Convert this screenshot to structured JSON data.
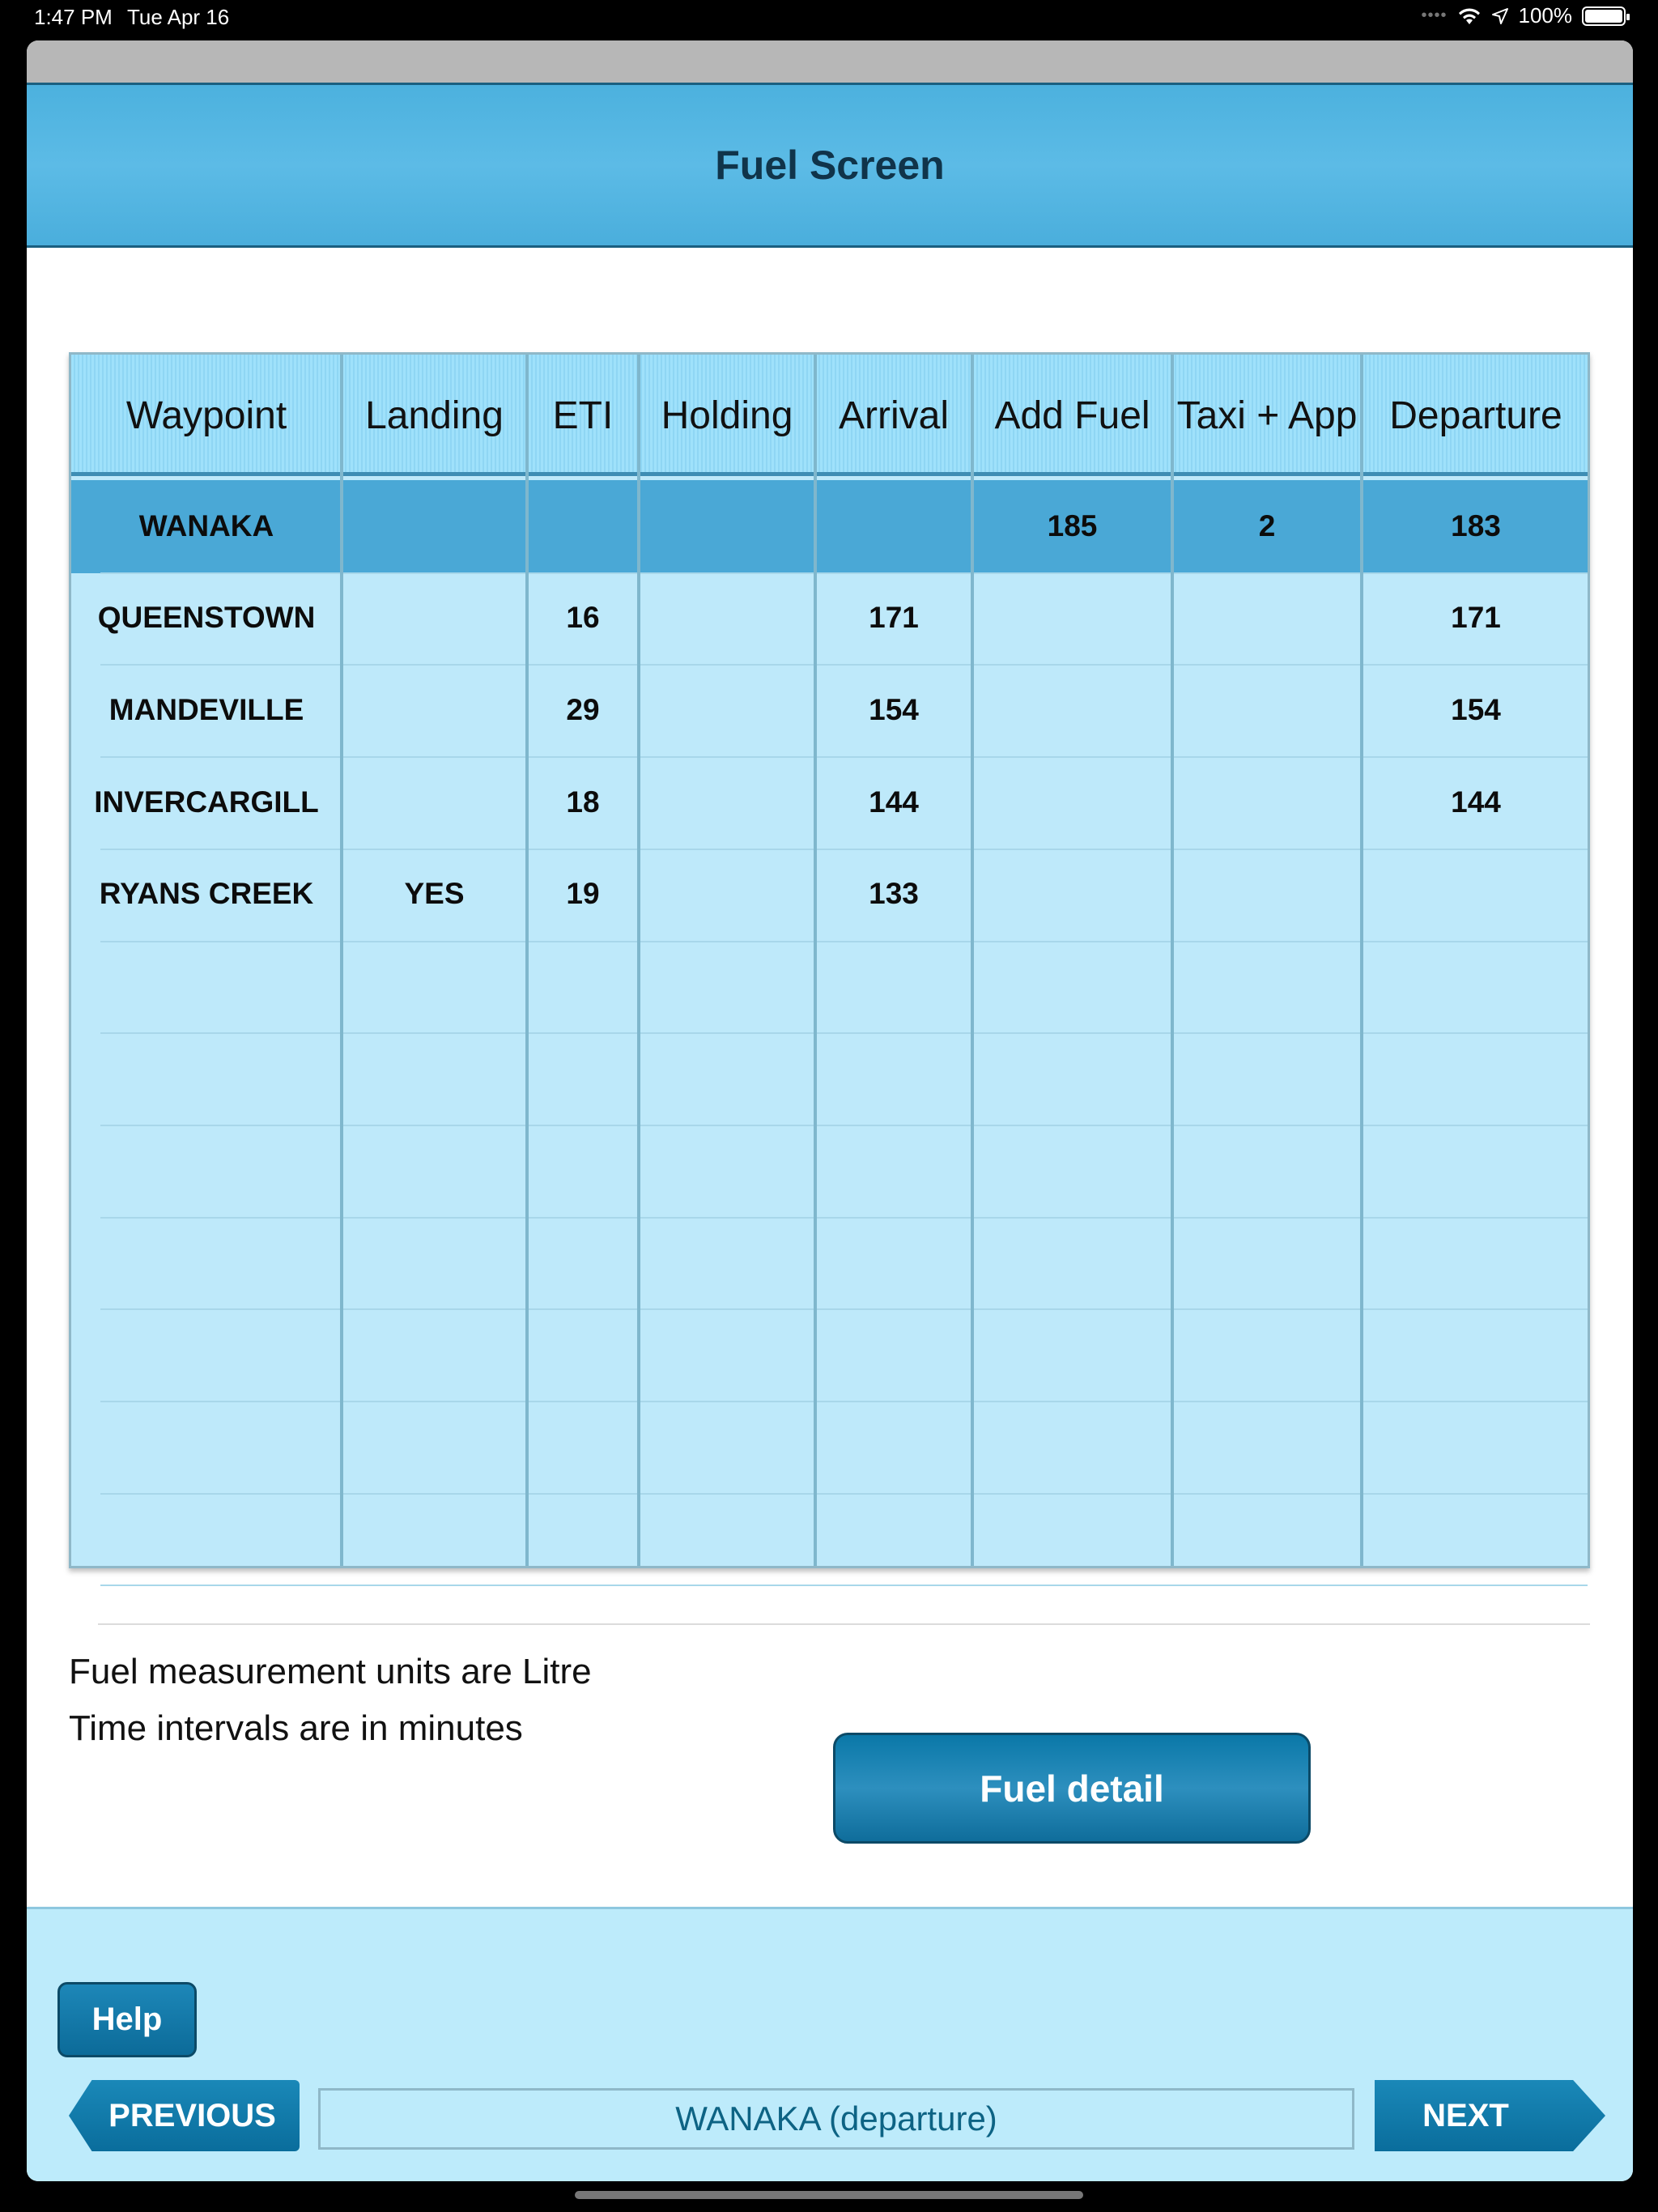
{
  "status_bar": {
    "time": "1:47 PM",
    "date": "Tue Apr 16",
    "battery": "100%"
  },
  "header": {
    "title": "Fuel Screen"
  },
  "table": {
    "columns": [
      "Waypoint",
      "Landing",
      "ETI",
      "Holding",
      "Arrival",
      "Add Fuel",
      "Taxi + App",
      "Departure"
    ],
    "rows": [
      {
        "waypoint": "WANAKA",
        "landing": "",
        "eti": "",
        "holding": "",
        "arrival": "",
        "add_fuel": "185",
        "taxi_app": "2",
        "departure": "183"
      },
      {
        "waypoint": "QUEENSTOWN",
        "landing": "",
        "eti": "16",
        "holding": "",
        "arrival": "171",
        "add_fuel": "",
        "taxi_app": "",
        "departure": "171"
      },
      {
        "waypoint": "MANDEVILLE",
        "landing": "",
        "eti": "29",
        "holding": "",
        "arrival": "154",
        "add_fuel": "",
        "taxi_app": "",
        "departure": "154"
      },
      {
        "waypoint": "INVERCARGILL",
        "landing": "",
        "eti": "18",
        "holding": "",
        "arrival": "144",
        "add_fuel": "",
        "taxi_app": "",
        "departure": "144"
      },
      {
        "waypoint": "RYANS CREEK",
        "landing": "YES",
        "eti": "19",
        "holding": "",
        "arrival": "133",
        "add_fuel": "",
        "taxi_app": "",
        "departure": ""
      }
    ]
  },
  "notes": {
    "units": "Fuel measurement units are Litre",
    "time": "Time intervals are in minutes"
  },
  "buttons": {
    "fuel_detail": "Fuel detail",
    "help": "Help",
    "previous": "PREVIOUS",
    "next": "NEXT"
  },
  "nav": {
    "current_waypoint": "WANAKA (departure)"
  }
}
